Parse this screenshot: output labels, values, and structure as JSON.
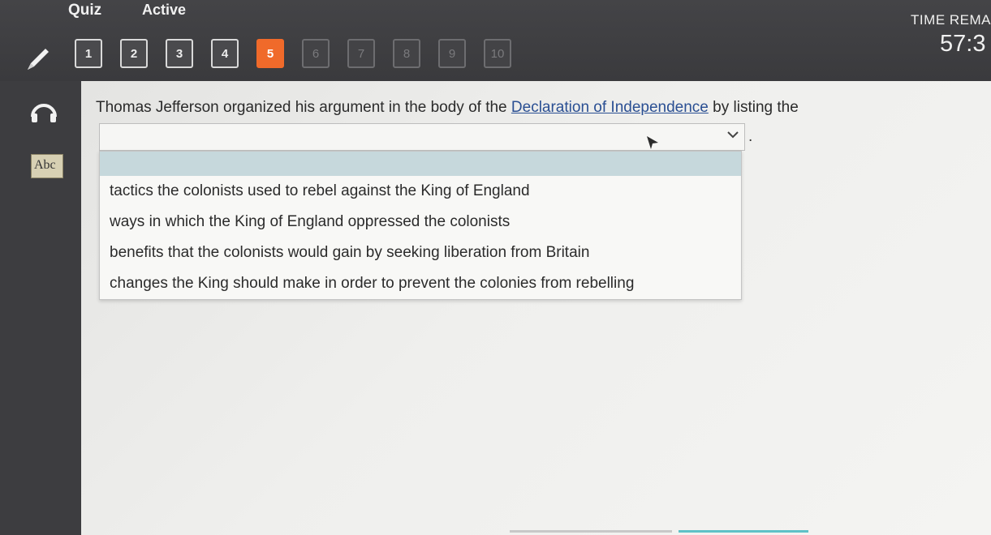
{
  "header": {
    "title": "Quiz",
    "status": "Active"
  },
  "timer": {
    "label": "TIME REMA",
    "value": "57:3"
  },
  "question_nav": [
    {
      "label": "1",
      "state": "answered"
    },
    {
      "label": "2",
      "state": "answered"
    },
    {
      "label": "3",
      "state": "answered"
    },
    {
      "label": "4",
      "state": "answered"
    },
    {
      "label": "5",
      "state": "current"
    },
    {
      "label": "6",
      "state": "unvisited"
    },
    {
      "label": "7",
      "state": "unvisited"
    },
    {
      "label": "8",
      "state": "unvisited"
    },
    {
      "label": "9",
      "state": "unvisited"
    },
    {
      "label": "10",
      "state": "unvisited"
    }
  ],
  "tools": {
    "pencil": "pencil-icon",
    "audio": "headphones-icon",
    "dictionary": "dictionary-icon",
    "dictionary_text": "Abc"
  },
  "question": {
    "text_before": "Thomas Jefferson organized his argument in the body of the ",
    "link_text": "Declaration of Independence",
    "text_after": " by listing the",
    "period": "."
  },
  "dropdown": {
    "selected": "",
    "options": [
      "tactics the colonists used to rebel against the King of England",
      "ways in which the King of England oppressed the colonists",
      "benefits that the colonists would gain by seeking liberation from Britain",
      "changes the King should make in order to prevent the colonies from rebelling"
    ]
  },
  "colors": {
    "accent": "#f06a2a",
    "link": "#2a4f93",
    "highlight": "#c6d8dc"
  }
}
